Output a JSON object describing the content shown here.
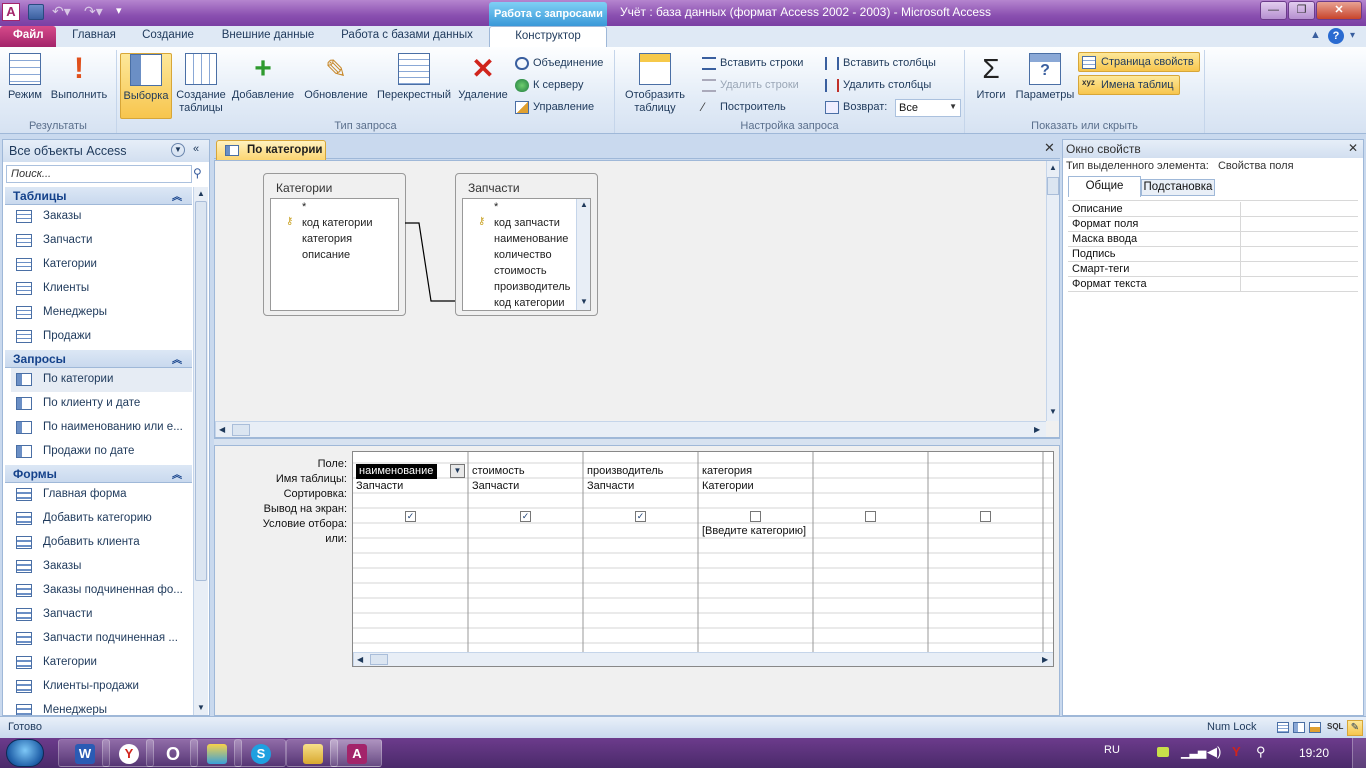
{
  "window": {
    "app_icon": "A",
    "title": "Учёт : база данных (формат Access 2002 - 2003)  -  Microsoft Access",
    "context_header": "Работа с запросами"
  },
  "tabs": {
    "file": "Файл",
    "items": [
      "Главная",
      "Создание",
      "Внешние данные",
      "Работа с базами данных",
      "Конструктор"
    ]
  },
  "ribbon": {
    "results": {
      "label": "Результаты",
      "mode": "Режим",
      "run": "Выполнить"
    },
    "query_type": {
      "label": "Тип запроса",
      "select": "Выборка",
      "make_table": "Создание таблицы",
      "append": "Добавление",
      "update": "Обновление",
      "crosstab": "Перекрестный",
      "delete": "Удаление",
      "union": "Объединение",
      "server": "К серверу",
      "manage": "Управление"
    },
    "setup": {
      "label": "Настройка запроса",
      "show_table": "Отобразить таблицу",
      "insert_rows": "Вставить строки",
      "delete_rows": "Удалить строки",
      "builder": "Построитель",
      "insert_cols": "Вставить столбцы",
      "delete_cols": "Удалить столбцы",
      "return_label": "Возврат:",
      "return_value": "Все"
    },
    "show_hide": {
      "label": "Показать или скрыть",
      "totals": "Итоги",
      "params": "Параметры",
      "property_sheet": "Страница свойств",
      "table_names": "Имена таблиц"
    }
  },
  "nav": {
    "title": "Все объекты Access",
    "search_placeholder": "Поиск...",
    "tables_label": "Таблицы",
    "tables": [
      "Заказы",
      "Запчасти",
      "Категории",
      "Клиенты",
      "Менеджеры",
      "Продажи"
    ],
    "queries_label": "Запросы",
    "queries": [
      "По категории",
      "По клиенту и дате",
      "По наименованию или е...",
      "Продажи по дате"
    ],
    "forms_label": "Формы",
    "forms": [
      "Главная форма",
      "Добавить категорию",
      "Добавить клиента",
      "Заказы",
      "Заказы подчиненная фо...",
      "Запчасти",
      "Запчасти подчиненная ...",
      "Категории",
      "Клиенты-продажи",
      "Менеджеры"
    ]
  },
  "doc": {
    "tab": "По категории",
    "table1": {
      "name": "Категории",
      "fields": [
        "*",
        "код категории",
        "категория",
        "описание"
      ]
    },
    "table2": {
      "name": "Запчасти",
      "fields": [
        "*",
        "код запчасти",
        "наименование",
        "количество",
        "стоимость",
        "производитель",
        "код категории"
      ]
    },
    "row_labels": [
      "Поле:",
      "Имя таблицы:",
      "Сортировка:",
      "Вывод на экран:",
      "Условие отбора:",
      "или:"
    ],
    "columns": [
      {
        "field": "наименование",
        "table": "Запчасти",
        "show": true,
        "criteria": ""
      },
      {
        "field": "стоимость",
        "table": "Запчасти",
        "show": true,
        "criteria": ""
      },
      {
        "field": "производитель",
        "table": "Запчасти",
        "show": true,
        "criteria": ""
      },
      {
        "field": "категория",
        "table": "Категории",
        "show": false,
        "criteria": "[Введите категорию]"
      },
      {
        "field": "",
        "table": "",
        "show": false,
        "criteria": ""
      },
      {
        "field": "",
        "table": "",
        "show": false,
        "criteria": ""
      }
    ]
  },
  "props": {
    "title": "Окно свойств",
    "selection_label": "Тип выделенного элемента:",
    "selection_value": "Свойства поля",
    "tab_general": "Общие",
    "tab_lookup": "Подстановка",
    "rows": [
      "Описание",
      "Формат поля",
      "Маска ввода",
      "Подпись",
      "Смарт-теги",
      "Формат текста"
    ]
  },
  "status": {
    "left": "Готово",
    "numlock": "Num Lock",
    "sql": "SQL"
  },
  "taskbar": {
    "lang": "RU",
    "time": "19:20"
  }
}
